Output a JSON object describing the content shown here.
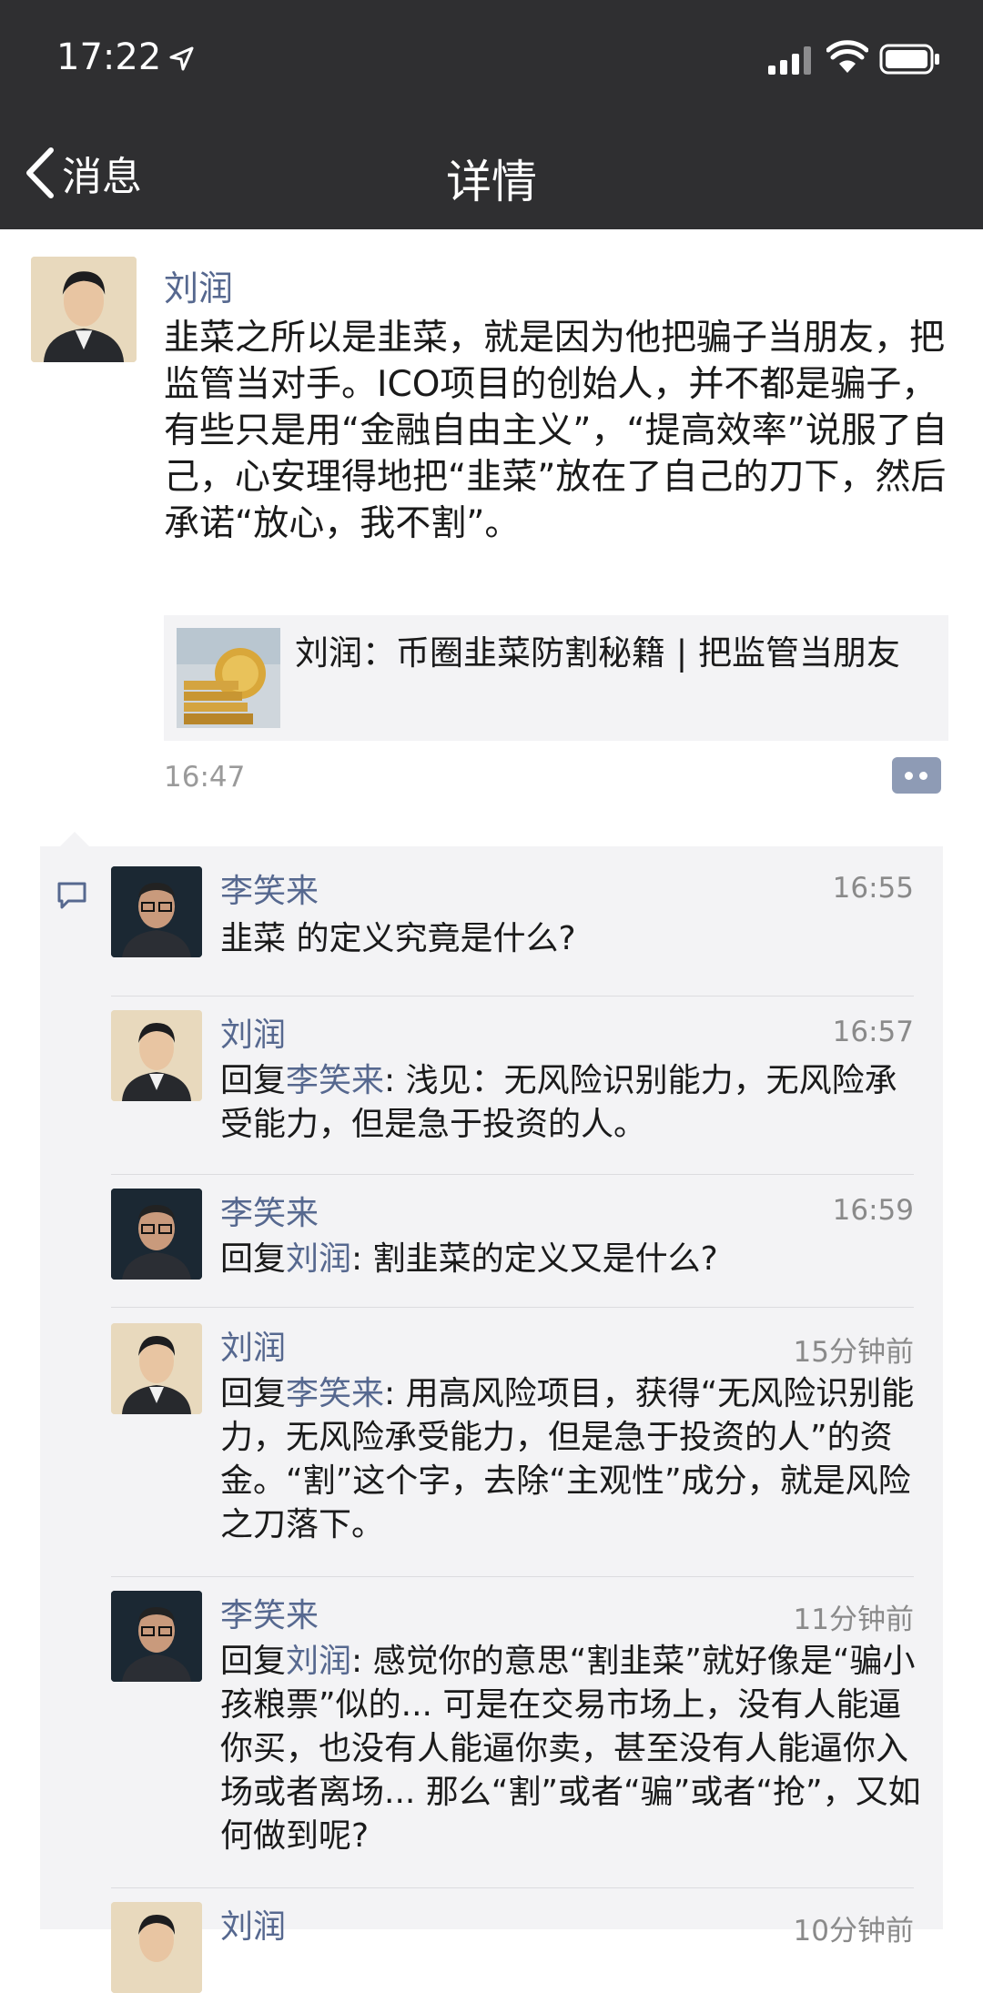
{
  "status_bar": {
    "time": "17:22"
  },
  "nav": {
    "back_label": "消息",
    "title": "详情"
  },
  "post": {
    "author": "刘润",
    "text": "韭菜之所以是韭菜，就是因为他把骗子当朋友，把监管当对手。ICO项目的创始人，并不都是骗子，有些只是用“金融自由主义”，“提高效率”说服了自己，心安理得地把“韭菜”放在了自己的刀下，然后承诺“放心，我不割”。",
    "article_title": "刘润：币圈韭菜防割秘籍 | 把监管当朋友",
    "time": "16:47"
  },
  "comments": [
    {
      "name": "李笑来",
      "time": "16:55",
      "text": "韭菜 的定义究竟是什么?"
    },
    {
      "name": "刘润",
      "time": "16:57",
      "reply_word": "回复",
      "reply_to": "李笑来",
      "text": ": 浅见：无风险识别能力，无风险承受能力，但是急于投资的人。"
    },
    {
      "name": "李笑来",
      "time": "16:59",
      "reply_word": "回复",
      "reply_to": "刘润",
      "text": ": 割韭菜的定义又是什么?"
    },
    {
      "name": "刘润",
      "time": "15分钟前",
      "reply_word": "回复",
      "reply_to": "李笑来",
      "text": ": 用高风险项目，获得“无风险识别能力，无风险承受能力，但是急于投资的人”的资金。“割”这个字，去除“主观性”成分，就是风险之刀落下。"
    },
    {
      "name": "李笑来",
      "time": "11分钟前",
      "reply_word": "回复",
      "reply_to": "刘润",
      "text": ": 感觉你的意思“割韭菜”就好像是“骗小孩粮票”似的... 可是在交易市场上，没有人能逼你买，也没有人能逼你卖，甚至没有人能逼你入场或者离场... 那么“割”或者“骗”或者“抢”，又如何做到呢?"
    },
    {
      "name": "刘润",
      "time": "10分钟前"
    }
  ]
}
